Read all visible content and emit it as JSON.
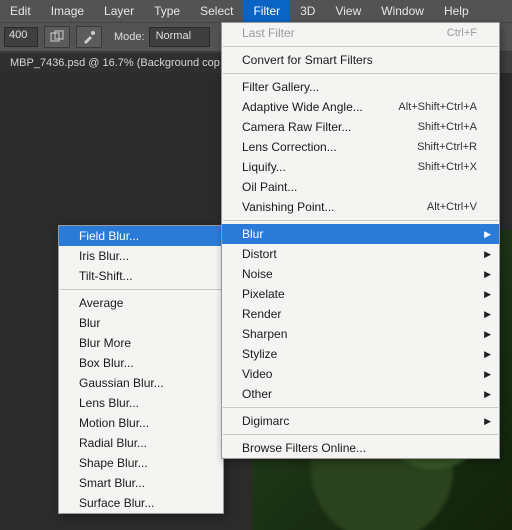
{
  "menubar": {
    "items": [
      "Edit",
      "Image",
      "Layer",
      "Type",
      "Select",
      "Filter",
      "3D",
      "View",
      "Window",
      "Help"
    ],
    "active_index": 5
  },
  "toolrow": {
    "numfield_value": "400",
    "mode_label": "Mode:",
    "mode_value": "Normal"
  },
  "doctab": {
    "title": "MBP_7436.psd @ 16.7% (Background cop"
  },
  "filter_menu": {
    "last_filter": {
      "label": "Last Filter",
      "shortcut": "Ctrl+F",
      "disabled": true
    },
    "convert_smart": {
      "label": "Convert for Smart Filters"
    },
    "filter_gallery": {
      "label": "Filter Gallery..."
    },
    "adaptive_wide": {
      "label": "Adaptive Wide Angle...",
      "shortcut": "Alt+Shift+Ctrl+A"
    },
    "camera_raw": {
      "label": "Camera Raw Filter...",
      "shortcut": "Shift+Ctrl+A"
    },
    "lens_correction": {
      "label": "Lens Correction...",
      "shortcut": "Shift+Ctrl+R"
    },
    "liquify": {
      "label": "Liquify...",
      "shortcut": "Shift+Ctrl+X"
    },
    "oil_paint": {
      "label": "Oil Paint..."
    },
    "vanishing_point": {
      "label": "Vanishing Point...",
      "shortcut": "Alt+Ctrl+V"
    },
    "blur": {
      "label": "Blur"
    },
    "distort": {
      "label": "Distort"
    },
    "noise": {
      "label": "Noise"
    },
    "pixelate": {
      "label": "Pixelate"
    },
    "render": {
      "label": "Render"
    },
    "sharpen": {
      "label": "Sharpen"
    },
    "stylize": {
      "label": "Stylize"
    },
    "video": {
      "label": "Video"
    },
    "other": {
      "label": "Other"
    },
    "digimarc": {
      "label": "Digimarc"
    },
    "browse_online": {
      "label": "Browse Filters Online..."
    }
  },
  "blur_submenu": {
    "field_blur": {
      "label": "Field Blur..."
    },
    "iris_blur": {
      "label": "Iris Blur..."
    },
    "tilt_shift": {
      "label": "Tilt-Shift..."
    },
    "average": {
      "label": "Average"
    },
    "blur": {
      "label": "Blur"
    },
    "blur_more": {
      "label": "Blur More"
    },
    "box_blur": {
      "label": "Box Blur..."
    },
    "gaussian_blur": {
      "label": "Gaussian Blur..."
    },
    "lens_blur": {
      "label": "Lens Blur..."
    },
    "motion_blur": {
      "label": "Motion Blur..."
    },
    "radial_blur": {
      "label": "Radial Blur..."
    },
    "shape_blur": {
      "label": "Shape Blur..."
    },
    "smart_blur": {
      "label": "Smart Blur..."
    },
    "surface_blur": {
      "label": "Surface Blur..."
    }
  }
}
